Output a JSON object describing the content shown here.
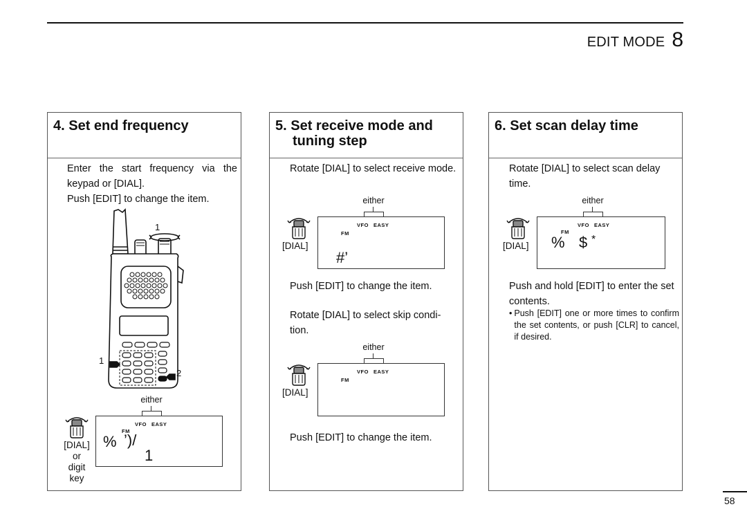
{
  "header": {
    "chapter_title": "EDIT MODE",
    "chapter_number": "8"
  },
  "panels": [
    {
      "title": "4. Set end frequency",
      "paragraphs": [
        "Enter the start frequency via the keypad or [DIAL].",
        "Push [EDIT] to change the item."
      ],
      "radio_callouts": [
        "1",
        "1",
        "2"
      ],
      "display": {
        "either_label": "either",
        "indicator_vfo": "VFO",
        "indicator_easy": "EASY",
        "mode": "FM",
        "line1_a": "%",
        "line1_b": "’)/",
        "line2": "1"
      },
      "dial_label": "[DIAL]",
      "dial_sub": [
        "or",
        "digit",
        "key"
      ]
    },
    {
      "title_line1": "5. Set receive mode and",
      "title_line2": "tuning step",
      "step1_text": "Rotate [DIAL] to select receive mode.",
      "display1": {
        "either_label": "either",
        "indicator_vfo": "VFO",
        "indicator_easy": "EASY",
        "mode": "FM",
        "value": "#’"
      },
      "dial_label": "[DIAL]",
      "step2_text": "Push [EDIT] to change the item.",
      "step3_text": "Rotate [DIAL] to select skip condi-tion.",
      "display2": {
        "either_label": "either",
        "indicator_vfo": "VFO",
        "indicator_easy": "EASY",
        "mode": "FM"
      },
      "step4_text": "Push [EDIT] to change the item."
    },
    {
      "title": "6. Set scan delay time",
      "step1_text": "Rotate [DIAL] to select scan delay time.",
      "display": {
        "either_label": "either",
        "indicator_vfo": "VFO",
        "indicator_easy": "EASY",
        "mode": "FM",
        "value_a": "%",
        "value_b": "$",
        "value_c": "*"
      },
      "dial_label": "[DIAL]",
      "step2_text": "Push and hold [EDIT] to enter the set contents.",
      "bullet": "Push [EDIT] one or more times to confirm the set contents, or push [CLR] to cancel, if desired."
    }
  ],
  "footer": {
    "page_number": "58"
  }
}
